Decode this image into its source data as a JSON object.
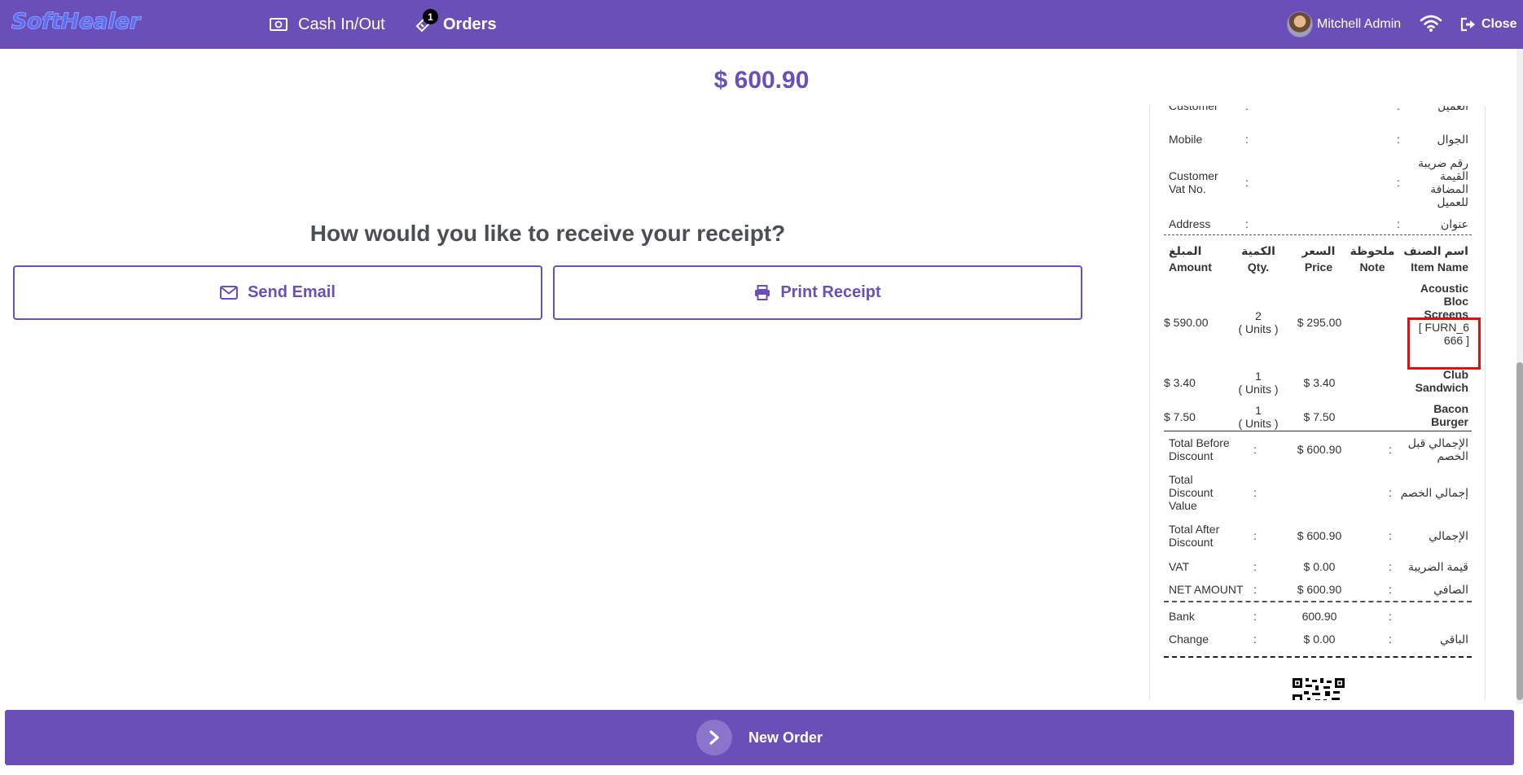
{
  "header": {
    "logo_text": "SoftHealer",
    "nav": [
      {
        "label": "Cash In/Out",
        "icon": "money-icon"
      },
      {
        "label": "Orders",
        "icon": "ticket-icon",
        "badge": "1"
      }
    ],
    "user_name": "Mitchell Admin",
    "close_label": "Close",
    "bg_color": "#6b4fb8"
  },
  "main": {
    "total": "$ 600.90",
    "question": "How would you like to receive your receipt?",
    "send_email_label": "Send Email",
    "print_receipt_label": "Print Receipt"
  },
  "receipt": {
    "info": [
      {
        "en": "Customer",
        "ar": "العميل",
        "value": ""
      },
      {
        "en": "Mobile",
        "ar": "الجوال",
        "value": ""
      },
      {
        "en": "Customer Vat No.",
        "ar": "رقم ضريبة القيمة المضافة للعميل",
        "value": ""
      },
      {
        "en": "Address",
        "ar": "عنوان",
        "value": ""
      }
    ],
    "colon": ":",
    "columns": {
      "amount_ar": "المبلغ",
      "amount": "Amount",
      "qty_ar": "الكمية",
      "qty": "Qty.",
      "price_ar": "السعر",
      "price": "Price",
      "note_ar": "ملحوظة",
      "note": "Note",
      "item_ar": "اسم الصنف",
      "item": "Item Name"
    },
    "lines": [
      {
        "amount": "$ 590.00",
        "qty": "2",
        "unit": "( Units )",
        "price": "$ 295.00",
        "name": "Acoustic Bloc Screens",
        "ref": "[ FURN_6666 ]"
      },
      {
        "amount": "$ 3.40",
        "qty": "1",
        "unit": "( Units )",
        "price": "$ 3.40",
        "name": "Club Sandwich",
        "ref": ""
      },
      {
        "amount": "$ 7.50",
        "qty": "1",
        "unit": "( Units )",
        "price": "$ 7.50",
        "name": "Bacon Burger",
        "ref": ""
      }
    ],
    "totals": [
      {
        "en": "Total Before Discount",
        "value": "$ 600.90",
        "ar": "الإجمالي قبل الخصم"
      },
      {
        "en": "Total Discount Value",
        "value": "",
        "ar": "إجمالي الخصم"
      },
      {
        "en": "Total After Discount",
        "value": "$ 600.90",
        "ar": "الإجمالي"
      },
      {
        "en": "VAT",
        "value": "$ 0.00",
        "ar": "قيمة الضريبة"
      },
      {
        "en": "NET AMOUNT",
        "value": "$ 600.90",
        "ar": "الصافي"
      }
    ],
    "payments": [
      {
        "en": "Bank",
        "value": "600.90",
        "ar": ""
      },
      {
        "en": "Change",
        "value": "$ 0.00",
        "ar": "الباقي"
      }
    ]
  },
  "footer": {
    "new_order_label": "New Order"
  }
}
